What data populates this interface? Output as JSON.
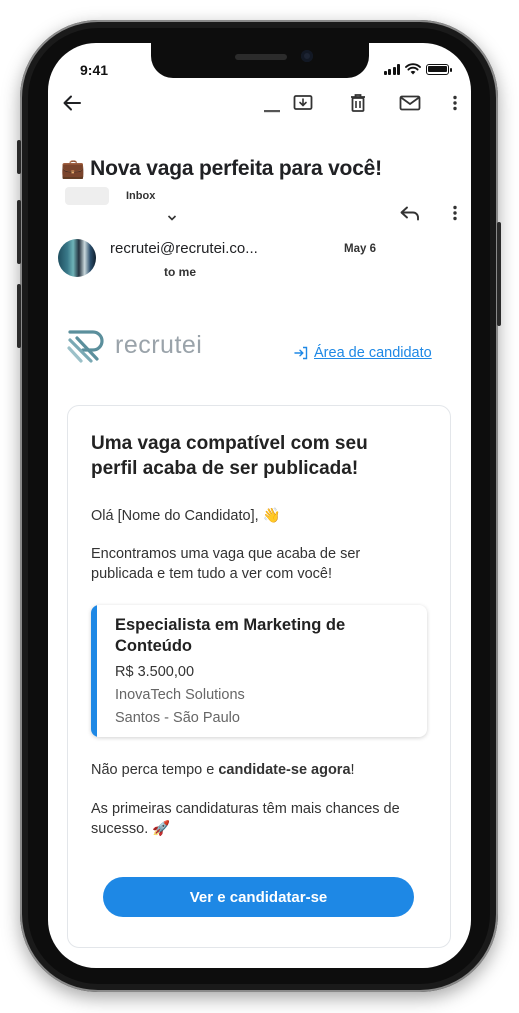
{
  "status": {
    "time": "9:41"
  },
  "email": {
    "subject_emoji": "💼",
    "subject": "Nova vaga perfeita para você!",
    "label": "Inbox",
    "sender": "recrutei@recrutei.co...",
    "date": "May 6",
    "recipient": "to me"
  },
  "icons": {
    "back": "back-arrow-icon",
    "archive": "archive-icon",
    "delete": "trash-icon",
    "mark_unread": "mail-icon",
    "more": "more-vertical-icon",
    "reply": "reply-icon",
    "expand": "chevron-down-icon"
  },
  "body": {
    "brand": "recrutei",
    "candidate_link": "Área de candidato",
    "card_title": "Uma vaga compatível com seu perfil acaba de ser publicada!",
    "greeting": "Olá [Nome do Candidato],",
    "greeting_emoji": "👋",
    "intro": "Encontramos uma vaga que acaba de ser publicada e tem tudo a ver com você!",
    "job": {
      "title": "Especialista em Marketing de Conteúdo",
      "salary": "R$ 3.500,00",
      "company": "InovaTech Solutions",
      "location": "Santos - São Paulo"
    },
    "urge_prefix": "Não perca tempo e ",
    "urge_bold": "candidate-se agora",
    "urge_suffix": "!",
    "chances": "As primeiras candidaturas têm mais chances de sucesso.",
    "chances_emoji": "🚀",
    "cta": "Ver e candidatar-se"
  },
  "colors": {
    "accent": "#1e88e5",
    "brand_gray": "#9aa3aa",
    "text": "#333333"
  }
}
